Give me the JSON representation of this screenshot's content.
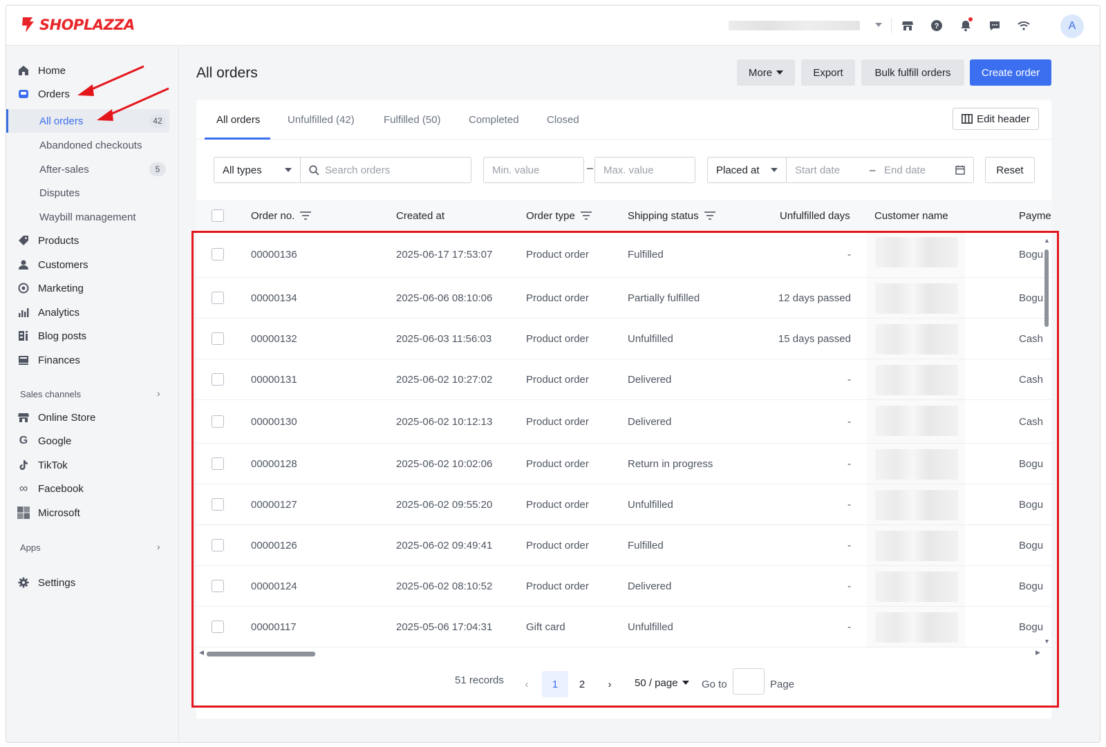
{
  "brand": {
    "name": "SHOPLAZZA",
    "color": "#e8262a"
  },
  "accent": "#3b6ff0",
  "topbar": {
    "icons": [
      "store-icon",
      "help-icon",
      "bell-icon",
      "chat-icon",
      "wifi-icon"
    ],
    "avatar_letter": "A"
  },
  "sidebar": {
    "home": "Home",
    "orders": "Orders",
    "orders_sub": {
      "all_orders": "All orders",
      "all_orders_badge": "42",
      "abandoned": "Abandoned checkouts",
      "after_sales": "After-sales",
      "after_sales_badge": "5",
      "disputes": "Disputes",
      "waybill": "Waybill management"
    },
    "products": "Products",
    "customers": "Customers",
    "marketing": "Marketing",
    "analytics": "Analytics",
    "blog_posts": "Blog posts",
    "finances": "Finances",
    "sales_channels_label": "Sales channels",
    "channels": {
      "online_store": "Online Store",
      "google": "Google",
      "tiktok": "TikTok",
      "facebook": "Facebook",
      "microsoft": "Microsoft"
    },
    "apps_label": "Apps",
    "settings": "Settings"
  },
  "page": {
    "title": "All orders",
    "actions": {
      "more": "More",
      "export": "Export",
      "bulk_fulfill": "Bulk fulfill orders",
      "create": "Create order"
    }
  },
  "tabs": {
    "all": "All orders",
    "unfulfilled": "Unfulfilled",
    "unfulfilled_count": "(42)",
    "fulfilled": "Fulfilled",
    "fulfilled_count": "(50)",
    "completed": "Completed",
    "closed": "Closed",
    "edit_header": "Edit header"
  },
  "filters": {
    "type_value": "All types",
    "search_placeholder": "Search orders",
    "min_placeholder": "Min. value",
    "max_placeholder": "Max. value",
    "date_field": "Placed at",
    "start_placeholder": "Start date",
    "end_placeholder": "End date",
    "reset": "Reset",
    "dash": "–"
  },
  "table": {
    "headers": {
      "order_no": "Order no.",
      "created_at": "Created at",
      "order_type": "Order type",
      "shipping_status": "Shipping status",
      "unfulfilled_days": "Unfulfilled days",
      "customer_name": "Customer name",
      "payment": "Paymei"
    },
    "rows": [
      {
        "order_no": "00000136",
        "created": "2025-06-17 17:53:07",
        "type": "Product order",
        "status": "Fulfilled",
        "days": "-",
        "payment": "Bogu"
      },
      {
        "order_no": "00000134",
        "created": "2025-06-06 08:10:06",
        "type": "Product order",
        "status": "Partially fulfilled",
        "days": "12 days passed",
        "payment": "Bogu"
      },
      {
        "order_no": "00000132",
        "created": "2025-06-03 11:56:03",
        "type": "Product order",
        "status": "Unfulfilled",
        "days": "15 days passed",
        "payment": "Cash"
      },
      {
        "order_no": "00000131",
        "created": "2025-06-02 10:27:02",
        "type": "Product order",
        "status": "Delivered",
        "days": "-",
        "payment": "Cash"
      },
      {
        "order_no": "00000130",
        "created": "2025-06-02 10:12:13",
        "type": "Product order",
        "status": "Delivered",
        "days": "-",
        "payment": "Cash"
      },
      {
        "order_no": "00000128",
        "created": "2025-06-02 10:02:06",
        "type": "Product order",
        "status": "Return in progress",
        "days": "-",
        "payment": "Bogu"
      },
      {
        "order_no": "00000127",
        "created": "2025-06-02 09:55:20",
        "type": "Product order",
        "status": "Unfulfilled",
        "days": "-",
        "payment": "Bogu"
      },
      {
        "order_no": "00000126",
        "created": "2025-06-02 09:49:41",
        "type": "Product order",
        "status": "Fulfilled",
        "days": "-",
        "payment": "Bogu"
      },
      {
        "order_no": "00000124",
        "created": "2025-06-02 08:10:52",
        "type": "Product order",
        "status": "Delivered",
        "days": "-",
        "payment": "Bogu"
      },
      {
        "order_no": "00000117",
        "created": "2025-05-06 17:04:31",
        "type": "Gift card",
        "status": "Unfulfilled",
        "days": "-",
        "payment": "Bogu"
      }
    ]
  },
  "pagination": {
    "records": "51 records",
    "page1": "1",
    "page2": "2",
    "page_size": "50 / page",
    "goto_label": "Go to",
    "page_label": "Page"
  },
  "annotation_color": "#e4161c"
}
